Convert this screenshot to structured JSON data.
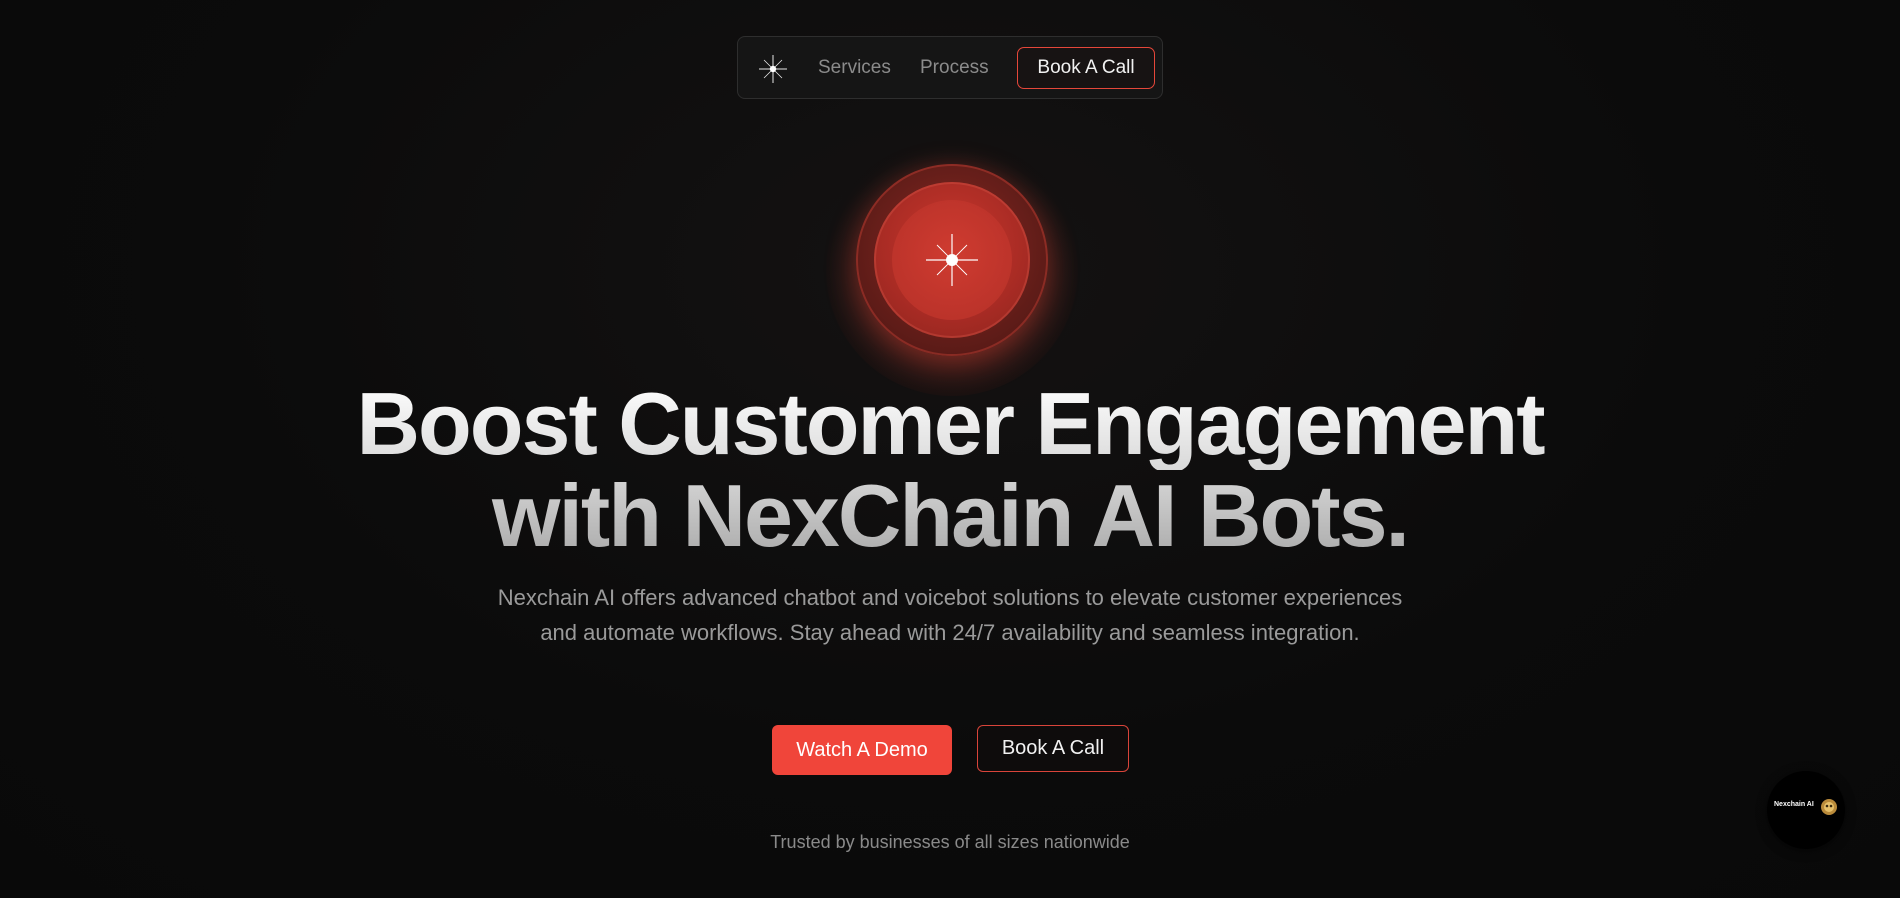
{
  "nav": {
    "logo_icon": "sparkle-star-icon",
    "links": [
      "Services",
      "Process"
    ],
    "cta_label": "Book A Call"
  },
  "hero": {
    "orb_icon": "sparkle-star-icon",
    "headline_line1": "Boost Customer Engagement",
    "headline_line2": "with NexChain AI Bots.",
    "subtext": "Nexchain AI offers advanced chatbot and voicebot solutions to elevate customer experiences and automate workflows. Stay ahead with 24/7 availability and seamless integration.",
    "primary_button": "Watch A Demo",
    "secondary_button": "Book A Call",
    "trusted_text": "Trusted by businesses of all sizes nationwide"
  },
  "widget": {
    "label": "Nexchain AI",
    "icon": "chat-bot-icon"
  },
  "colors": {
    "background": "#0b0b0b",
    "accent": "#f0453a",
    "orb": "#c9372d",
    "muted_text": "#9a9a9a"
  }
}
